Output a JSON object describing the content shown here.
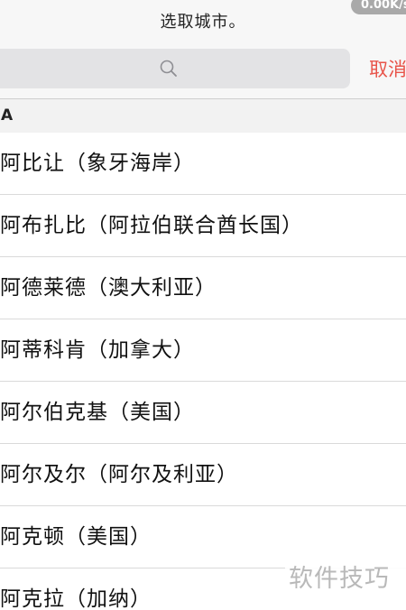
{
  "header": {
    "prompt": "选取城市。",
    "network_speed": "0.00K/s",
    "search": {
      "placeholder": ""
    },
    "cancel_label": "取消"
  },
  "section": {
    "letter": "A"
  },
  "cities": [
    {
      "label": "阿比让（象牙海岸）"
    },
    {
      "label": "阿布扎比（阿拉伯联合酋长国）"
    },
    {
      "label": "阿德莱德（澳大利亚）"
    },
    {
      "label": "阿蒂科肯（加拿大）"
    },
    {
      "label": "阿尔伯克基（美国）"
    },
    {
      "label": "阿尔及尔（阿尔及利亚）"
    },
    {
      "label": "阿克顿（美国）"
    },
    {
      "label": "阿克拉（加纳）"
    }
  ],
  "watermark": "软件技巧",
  "colors": {
    "accent": "#e8544a",
    "search_bg": "#e3e3e5",
    "header_bg": "#f7f7f7"
  },
  "icons": {
    "search": "search-icon"
  }
}
